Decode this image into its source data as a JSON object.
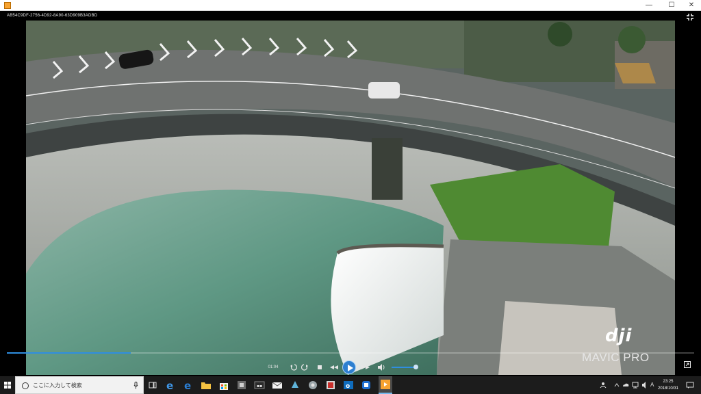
{
  "window": {
    "title": "",
    "controls": {
      "minimize": "—",
      "maximize": "☐",
      "close": "✕"
    }
  },
  "player": {
    "file_name": "AB54C9DF-2756-4D92-8A90-63D909B3ADBD",
    "current_time": "01:04",
    "progress": 0.18,
    "volume": 0.85,
    "watermark_brand": "dji",
    "watermark_model": "MAVIC PRO",
    "icons": [
      "fullscreen-icon",
      "rotate-left-icon",
      "rotate-right-icon",
      "stop-icon",
      "rewind-icon",
      "play-icon",
      "fast-forward-icon",
      "volume-icon",
      "popout-icon"
    ]
  },
  "taskbar": {
    "search_placeholder": "ここに入力して検索",
    "clock_time": "23:25",
    "clock_date": "2018/10/31",
    "ime_indicator": "A",
    "pinned_icons": [
      "task-view-icon",
      "edge-icon",
      "ie-icon",
      "file-explorer-icon",
      "store-icon",
      "app-icon-1",
      "app-icon-2",
      "mail-icon",
      "app-icon-3",
      "app-icon-4",
      "app-icon-5",
      "outlook-icon",
      "app-icon-6",
      "media-player-icon"
    ],
    "accent": "#76b9ed"
  },
  "colors": {
    "player_accent": "#2f8ee0",
    "taskbar_bg": "#1c1c1c"
  }
}
